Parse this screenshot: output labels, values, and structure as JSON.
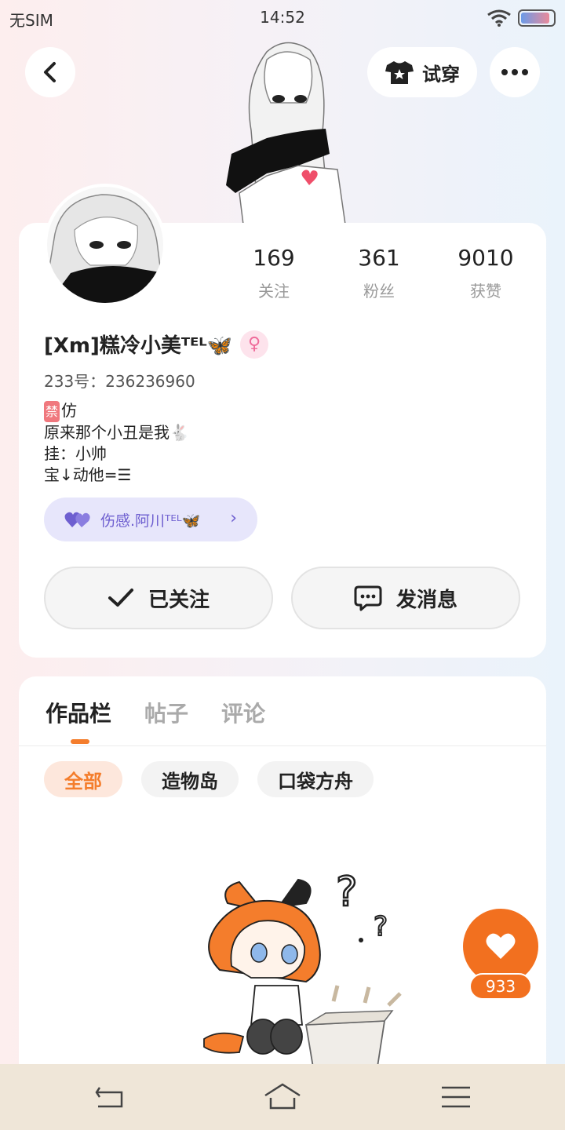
{
  "status_bar": {
    "carrier": "无SIM",
    "time": "14:52",
    "battery_level": 0.9
  },
  "header": {
    "try_on_label": "试穿"
  },
  "stats": [
    {
      "value": "169",
      "label": "关注"
    },
    {
      "value": "361",
      "label": "粉丝"
    },
    {
      "value": "9010",
      "label": "获赞"
    }
  ],
  "profile": {
    "nickname": "[Xm]糕冷小美ᵀᴱᴸ🦋",
    "gender_symbol": "♀",
    "uid": "233号：236236960",
    "bio": {
      "ban_mark": "禁",
      "line1": "仿",
      "line2": "原来那个小丑是我🐇",
      "line3": "挂：小帅",
      "line4": "宝↓动他=☰"
    }
  },
  "group_pill": {
    "label": "伤感.阿川ᵀᴱᴸ🦋"
  },
  "actions": {
    "follow_label": "已关注",
    "message_label": "发消息"
  },
  "tabs": [
    {
      "label": "作品栏",
      "active": true
    },
    {
      "label": "帖子",
      "active": false
    },
    {
      "label": "评论",
      "active": false
    }
  ],
  "chips": [
    {
      "label": "全部",
      "active": true
    },
    {
      "label": "造物岛",
      "active": false
    },
    {
      "label": "口袋方舟",
      "active": false
    }
  ],
  "like_fab": {
    "count": "933"
  },
  "colors": {
    "accent": "#f2701f",
    "purple_pill": "#e7e6fb",
    "nav_bg": "#efe6d8"
  },
  "icons": [
    "back-arrow-icon",
    "tshirt-icon",
    "more-dots-icon",
    "check-icon",
    "chat-bubble-icon",
    "heart-icon",
    "wifi-icon",
    "battery-icon",
    "nav-back-icon",
    "nav-home-icon",
    "nav-menu-icon"
  ]
}
